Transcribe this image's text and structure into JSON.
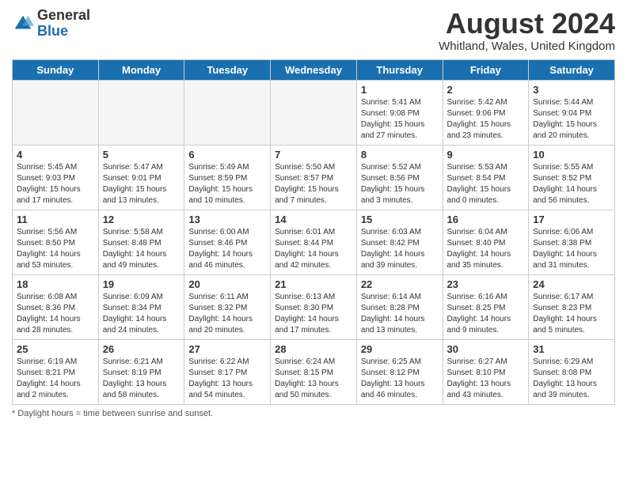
{
  "header": {
    "logo_general": "General",
    "logo_blue": "Blue",
    "month_title": "August 2024",
    "location": "Whitland, Wales, United Kingdom"
  },
  "days_of_week": [
    "Sunday",
    "Monday",
    "Tuesday",
    "Wednesday",
    "Thursday",
    "Friday",
    "Saturday"
  ],
  "footer": {
    "note": "Daylight hours"
  },
  "weeks": [
    [
      {
        "day": "",
        "info": ""
      },
      {
        "day": "",
        "info": ""
      },
      {
        "day": "",
        "info": ""
      },
      {
        "day": "",
        "info": ""
      },
      {
        "day": "1",
        "info": "Sunrise: 5:41 AM\nSunset: 9:08 PM\nDaylight: 15 hours\nand 27 minutes."
      },
      {
        "day": "2",
        "info": "Sunrise: 5:42 AM\nSunset: 9:06 PM\nDaylight: 15 hours\nand 23 minutes."
      },
      {
        "day": "3",
        "info": "Sunrise: 5:44 AM\nSunset: 9:04 PM\nDaylight: 15 hours\nand 20 minutes."
      }
    ],
    [
      {
        "day": "4",
        "info": "Sunrise: 5:45 AM\nSunset: 9:03 PM\nDaylight: 15 hours\nand 17 minutes."
      },
      {
        "day": "5",
        "info": "Sunrise: 5:47 AM\nSunset: 9:01 PM\nDaylight: 15 hours\nand 13 minutes."
      },
      {
        "day": "6",
        "info": "Sunrise: 5:49 AM\nSunset: 8:59 PM\nDaylight: 15 hours\nand 10 minutes."
      },
      {
        "day": "7",
        "info": "Sunrise: 5:50 AM\nSunset: 8:57 PM\nDaylight: 15 hours\nand 7 minutes."
      },
      {
        "day": "8",
        "info": "Sunrise: 5:52 AM\nSunset: 8:56 PM\nDaylight: 15 hours\nand 3 minutes."
      },
      {
        "day": "9",
        "info": "Sunrise: 5:53 AM\nSunset: 8:54 PM\nDaylight: 15 hours\nand 0 minutes."
      },
      {
        "day": "10",
        "info": "Sunrise: 5:55 AM\nSunset: 8:52 PM\nDaylight: 14 hours\nand 56 minutes."
      }
    ],
    [
      {
        "day": "11",
        "info": "Sunrise: 5:56 AM\nSunset: 8:50 PM\nDaylight: 14 hours\nand 53 minutes."
      },
      {
        "day": "12",
        "info": "Sunrise: 5:58 AM\nSunset: 8:48 PM\nDaylight: 14 hours\nand 49 minutes."
      },
      {
        "day": "13",
        "info": "Sunrise: 6:00 AM\nSunset: 8:46 PM\nDaylight: 14 hours\nand 46 minutes."
      },
      {
        "day": "14",
        "info": "Sunrise: 6:01 AM\nSunset: 8:44 PM\nDaylight: 14 hours\nand 42 minutes."
      },
      {
        "day": "15",
        "info": "Sunrise: 6:03 AM\nSunset: 8:42 PM\nDaylight: 14 hours\nand 39 minutes."
      },
      {
        "day": "16",
        "info": "Sunrise: 6:04 AM\nSunset: 8:40 PM\nDaylight: 14 hours\nand 35 minutes."
      },
      {
        "day": "17",
        "info": "Sunrise: 6:06 AM\nSunset: 8:38 PM\nDaylight: 14 hours\nand 31 minutes."
      }
    ],
    [
      {
        "day": "18",
        "info": "Sunrise: 6:08 AM\nSunset: 8:36 PM\nDaylight: 14 hours\nand 28 minutes."
      },
      {
        "day": "19",
        "info": "Sunrise: 6:09 AM\nSunset: 8:34 PM\nDaylight: 14 hours\nand 24 minutes."
      },
      {
        "day": "20",
        "info": "Sunrise: 6:11 AM\nSunset: 8:32 PM\nDaylight: 14 hours\nand 20 minutes."
      },
      {
        "day": "21",
        "info": "Sunrise: 6:13 AM\nSunset: 8:30 PM\nDaylight: 14 hours\nand 17 minutes."
      },
      {
        "day": "22",
        "info": "Sunrise: 6:14 AM\nSunset: 8:28 PM\nDaylight: 14 hours\nand 13 minutes."
      },
      {
        "day": "23",
        "info": "Sunrise: 6:16 AM\nSunset: 8:25 PM\nDaylight: 14 hours\nand 9 minutes."
      },
      {
        "day": "24",
        "info": "Sunrise: 6:17 AM\nSunset: 8:23 PM\nDaylight: 14 hours\nand 5 minutes."
      }
    ],
    [
      {
        "day": "25",
        "info": "Sunrise: 6:19 AM\nSunset: 8:21 PM\nDaylight: 14 hours\nand 2 minutes."
      },
      {
        "day": "26",
        "info": "Sunrise: 6:21 AM\nSunset: 8:19 PM\nDaylight: 13 hours\nand 58 minutes."
      },
      {
        "day": "27",
        "info": "Sunrise: 6:22 AM\nSunset: 8:17 PM\nDaylight: 13 hours\nand 54 minutes."
      },
      {
        "day": "28",
        "info": "Sunrise: 6:24 AM\nSunset: 8:15 PM\nDaylight: 13 hours\nand 50 minutes."
      },
      {
        "day": "29",
        "info": "Sunrise: 6:25 AM\nSunset: 8:12 PM\nDaylight: 13 hours\nand 46 minutes."
      },
      {
        "day": "30",
        "info": "Sunrise: 6:27 AM\nSunset: 8:10 PM\nDaylight: 13 hours\nand 43 minutes."
      },
      {
        "day": "31",
        "info": "Sunrise: 6:29 AM\nSunset: 8:08 PM\nDaylight: 13 hours\nand 39 minutes."
      }
    ]
  ]
}
